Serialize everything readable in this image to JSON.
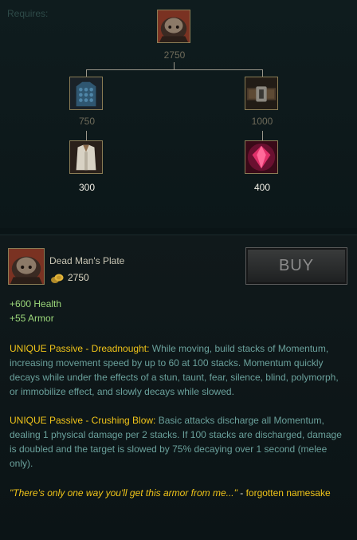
{
  "tree": {
    "requires_label": "Requires:",
    "root_price": "2750",
    "mid_left_price": "750",
    "mid_right_price": "1000",
    "leaf_left_price": "300",
    "leaf_right_price": "400"
  },
  "item": {
    "name": "Dead Man's Plate",
    "cost": "2750",
    "buy_label": "BUY",
    "stats": [
      "+600 Health",
      "+55 Armor"
    ],
    "passive1": {
      "label": "UNIQUE Passive - Dreadnought:",
      "text": "While moving, build stacks of Momentum, increasing movement speed by up to 60 at 100 stacks. Momentum quickly decays while under the effects of a stun, taunt, fear, silence, blind, polymorph, or immobilize effect, and slowly decays while slowed."
    },
    "passive2": {
      "label": "UNIQUE Passive - Crushing Blow:",
      "text": "Basic attacks discharge all Momentum, dealing 1 physical damage per 2 stacks. If 100 stacks are discharged, damage is doubled and the target is slowed by 75% decaying over 1 second (melee only)."
    },
    "quote": {
      "text": "\"There's only one way you'll get this armor from me...\"",
      "dash": "-",
      "attribution": "forgotten namesake"
    }
  },
  "colors": {
    "gold": "#f0c419",
    "stat_green": "#9bd77a",
    "description_teal": "#6aa09b"
  },
  "icons": [
    "dead-mans-plate-icon",
    "chain-vest-icon",
    "giants-belt-icon",
    "cloth-armor-icon",
    "ruby-crystal-icon",
    "gold-coins-icon"
  ]
}
